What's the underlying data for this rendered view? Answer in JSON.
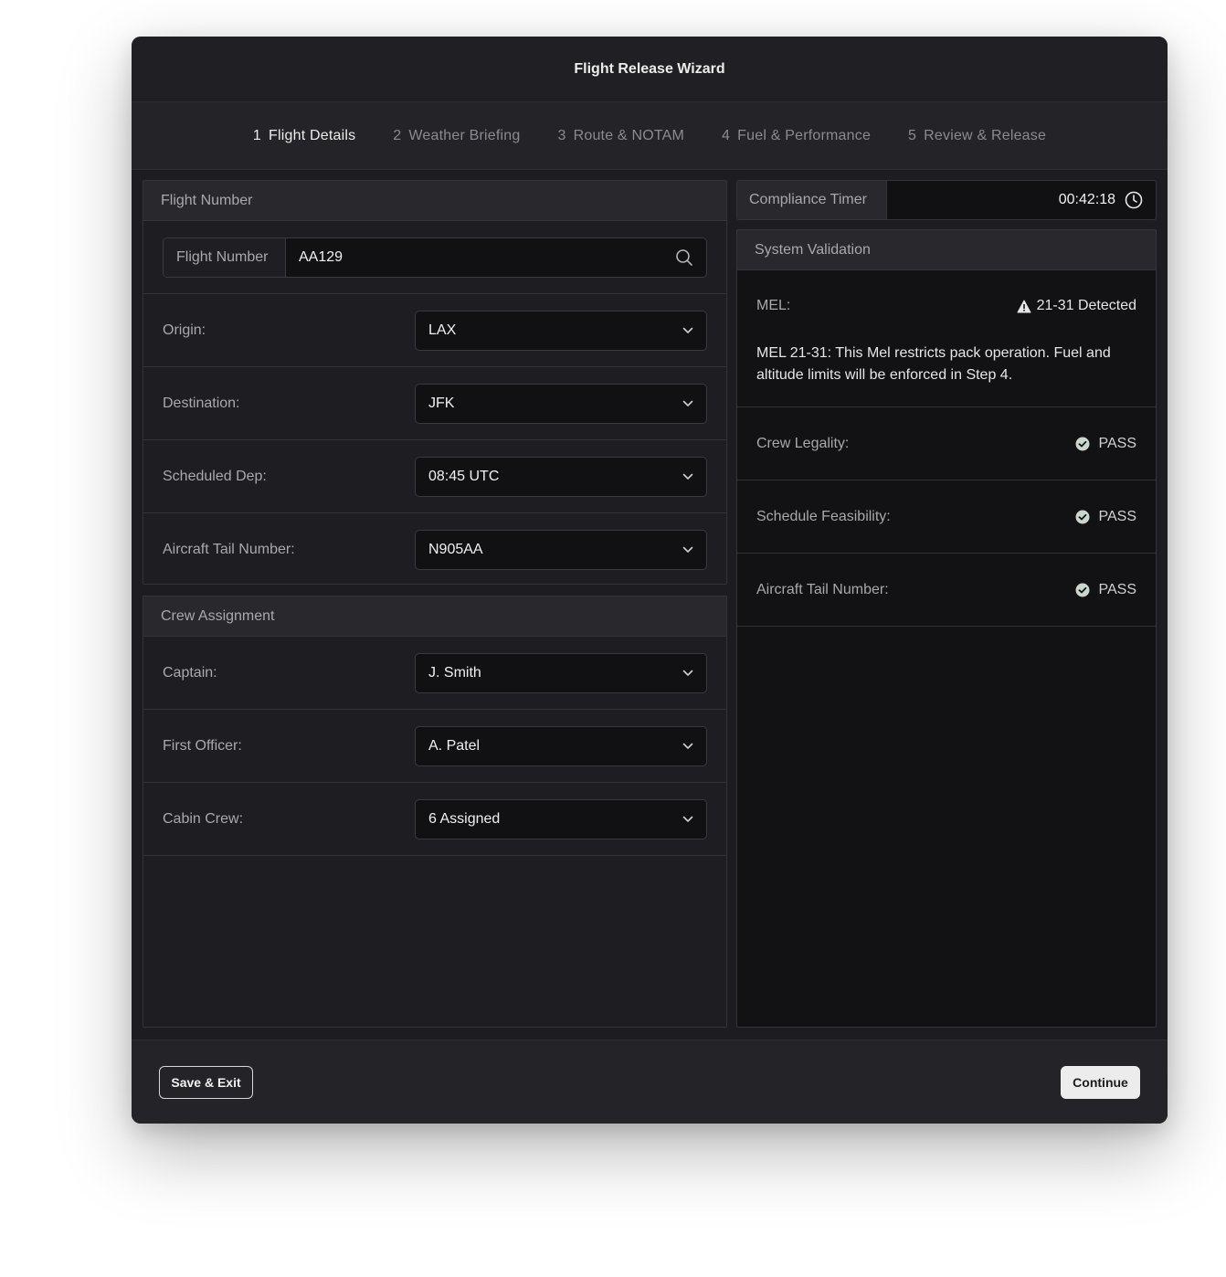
{
  "window": {
    "title": "Flight Release Wizard"
  },
  "steps": [
    {
      "num": "1",
      "label": "Flight Details",
      "active": true
    },
    {
      "num": "2",
      "label": "Weather Briefing",
      "active": false
    },
    {
      "num": "3",
      "label": "Route & NOTAM",
      "active": false
    },
    {
      "num": "4",
      "label": "Fuel & Performance",
      "active": false
    },
    {
      "num": "5",
      "label": "Review & Release",
      "active": false
    }
  ],
  "flight": {
    "header": "Flight Number",
    "search": {
      "prefix": "Flight Number",
      "value": "AA129"
    },
    "fields": [
      {
        "label": "Origin:",
        "value": "LAX"
      },
      {
        "label": "Destination:",
        "value": "JFK"
      },
      {
        "label": "Scheduled Dep:",
        "value": "08:45 UTC"
      },
      {
        "label": "Aircraft Tail Number:",
        "value": "N905AA"
      }
    ]
  },
  "crew": {
    "header": "Crew Assignment",
    "fields": [
      {
        "label": "Captain:",
        "value": "J. Smith"
      },
      {
        "label": "First Officer:",
        "value": "A. Patel"
      },
      {
        "label": "Cabin Crew:",
        "value": "6 Assigned"
      }
    ]
  },
  "timer": {
    "label": "Compliance Timer",
    "value": "00:42:18",
    "icon": "clock-icon"
  },
  "validation": {
    "header": "System Validation",
    "mel": {
      "label": "MEL:",
      "status": "21-31 Detected",
      "icon": "warning-icon",
      "message": "MEL 21-31: This Mel restricts pack operation. Fuel and altitude limits will be enforced in Step 4."
    },
    "checks": [
      {
        "label": "Crew Legality:",
        "status": "PASS"
      },
      {
        "label": "Schedule Feasibility:",
        "status": "PASS"
      },
      {
        "label": "Aircraft Tail Number:",
        "status": "PASS"
      }
    ],
    "pass_color": "#c9d8cf"
  },
  "footer": {
    "save_label": "Save & Exit",
    "continue_label": "Continue"
  }
}
